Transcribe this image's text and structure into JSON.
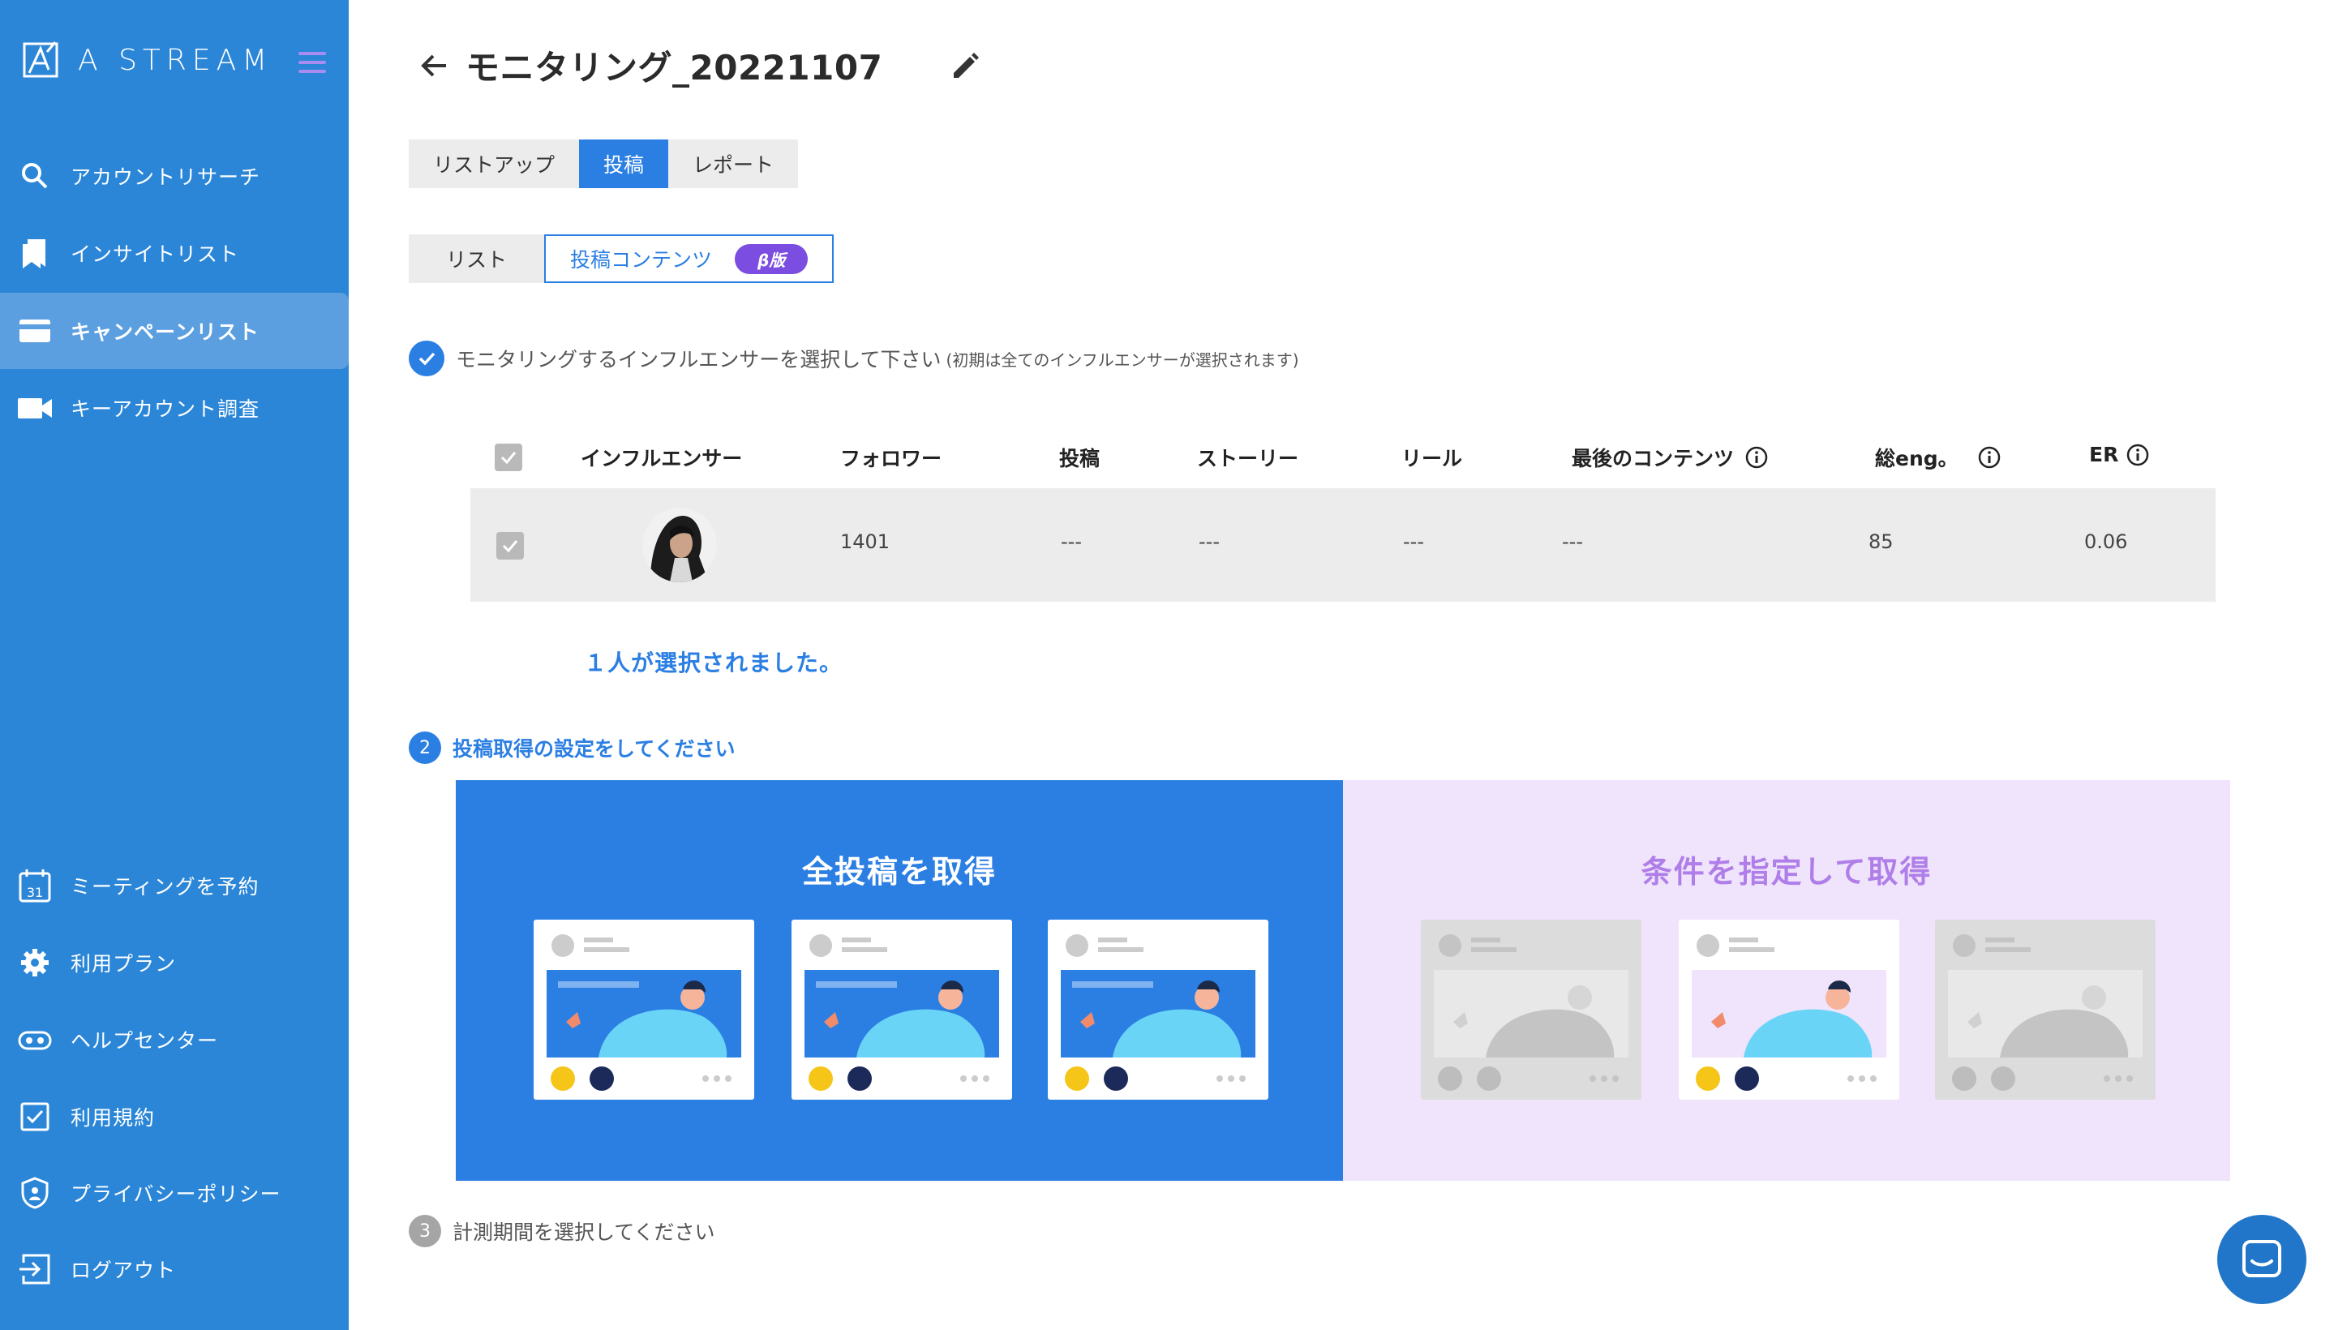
{
  "sidebar": {
    "brand": "A STREAM",
    "items": [
      {
        "label": "アカウントリサーチ",
        "icon": "search-icon"
      },
      {
        "label": "インサイトリスト",
        "icon": "bookmark-icon"
      },
      {
        "label": "キャンペーンリスト",
        "icon": "card-icon",
        "active": true
      },
      {
        "label": "キーアカウント調査",
        "icon": "video-icon"
      },
      {
        "label": "ミーティングを予約",
        "icon": "calendar-icon",
        "calendar_day": "31"
      },
      {
        "label": "利用プラン",
        "icon": "gear-icon"
      },
      {
        "label": "ヘルプセンター",
        "icon": "help-icon"
      },
      {
        "label": "利用規約",
        "icon": "checkbox-icon"
      },
      {
        "label": "プライバシーポリシー",
        "icon": "shield-icon"
      },
      {
        "label": "ログアウト",
        "icon": "logout-icon"
      }
    ]
  },
  "header": {
    "title": "モニタリング_20221107"
  },
  "tabs": [
    {
      "label": "リストアップ"
    },
    {
      "label": "投稿",
      "active": true
    },
    {
      "label": "レポート"
    }
  ],
  "subtabs": [
    {
      "label": "リスト"
    },
    {
      "label": "投稿コンテンツ",
      "active": true,
      "badge": "β版"
    }
  ],
  "steps": {
    "step1": {
      "text": "モニタリングするインフルエンサーを選択して下さい",
      "note": "(初期は全てのインフルエンサーが選択されます)"
    },
    "step2": {
      "number": "2",
      "text": "投稿取得の設定をしてください"
    },
    "step3": {
      "number": "3",
      "text": "計測期間を選択してください"
    }
  },
  "table": {
    "headers": [
      "インフルエンサー",
      "フォロワー",
      "投稿",
      "ストーリー",
      "リール",
      "最後のコンテンツ",
      "総eng。",
      "ER"
    ],
    "rows": [
      {
        "followers": "1401",
        "posts": "---",
        "stories": "---",
        "reels": "---",
        "last_content": "---",
        "total_eng": "85",
        "er": "0.06"
      }
    ]
  },
  "selected_count": "１人が選択されました。",
  "options": {
    "all": "全投稿を取得",
    "conditional": "条件を指定して取得"
  },
  "colors": {
    "sidebar": "#2b86d8",
    "accent": "#2b7fe3",
    "beta": "#7b4de0",
    "lavender": "#efe4fc"
  }
}
